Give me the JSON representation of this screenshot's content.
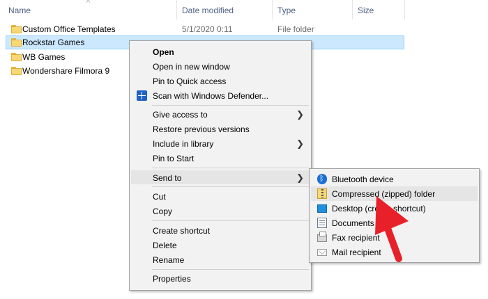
{
  "columns": {
    "name": "Name",
    "date_modified": "Date modified",
    "type": "Type",
    "size": "Size"
  },
  "files": [
    {
      "name": "Custom Office Templates",
      "date": "5/1/2020 0:11",
      "type": "File folder"
    },
    {
      "name": "Rockstar Games",
      "date": "",
      "type": ""
    },
    {
      "name": "WB Games",
      "date": "",
      "type": ""
    },
    {
      "name": "Wondershare Filmora 9",
      "date": "",
      "type": ""
    }
  ],
  "context_menu": {
    "items": [
      {
        "label": "Open"
      },
      {
        "label": "Open in new window"
      },
      {
        "label": "Pin to Quick access"
      },
      {
        "label": "Scan with Windows Defender..."
      },
      {
        "label": "Give access to"
      },
      {
        "label": "Restore previous versions"
      },
      {
        "label": "Include in library"
      },
      {
        "label": "Pin to Start"
      },
      {
        "label": "Send to"
      },
      {
        "label": "Cut"
      },
      {
        "label": "Copy"
      },
      {
        "label": "Create shortcut"
      },
      {
        "label": "Delete"
      },
      {
        "label": "Rename"
      },
      {
        "label": "Properties"
      }
    ],
    "submenu_arrow": "❯"
  },
  "send_to_menu": {
    "items": [
      {
        "label": "Bluetooth device",
        "icon": "bluetooth-icon"
      },
      {
        "label": "Compressed (zipped) folder",
        "icon": "zip-folder-icon"
      },
      {
        "label": "Desktop (create shortcut)",
        "icon": "desktop-icon"
      },
      {
        "label": "Documents",
        "icon": "documents-icon"
      },
      {
        "label": "Fax recipient",
        "icon": "fax-icon"
      },
      {
        "label": "Mail recipient",
        "icon": "mail-icon"
      }
    ]
  },
  "colors": {
    "selection_bg": "#cce8ff",
    "menu_bg": "#f2f2f2",
    "annotation_arrow": "#e8202a"
  }
}
